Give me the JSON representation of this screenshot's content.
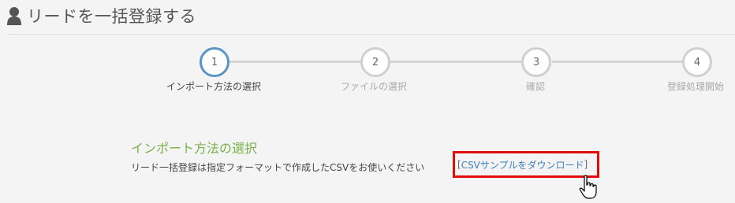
{
  "header": {
    "icon": "user-icon",
    "title": "リードを一括登録する"
  },
  "stepper": {
    "current_step": 1,
    "steps": [
      {
        "number": "1",
        "label": "インポート方法の選択"
      },
      {
        "number": "2",
        "label": "ファイルの選択"
      },
      {
        "number": "3",
        "label": "確認"
      },
      {
        "number": "4",
        "label": "登録処理開始"
      }
    ]
  },
  "section": {
    "heading": "インポート方法の選択",
    "description": "リード一括登録は指定フォーマットで作成したCSVをお使いください",
    "bracket_open": "[",
    "link_label": "CSVサンプルをダウンロード",
    "bracket_close": "]"
  },
  "colors": {
    "accent_green": "#79b04a",
    "active_step": "#5b93c7",
    "link_blue": "#3c7fc0",
    "highlight_red": "#e10d0d"
  }
}
